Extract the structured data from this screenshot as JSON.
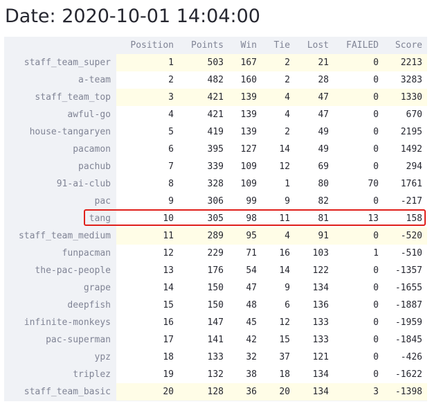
{
  "title": "Date: 2020-10-01 14:04:00",
  "columns": [
    "Position",
    "Points",
    "Win",
    "Tie",
    "Lost",
    "FAILED",
    "Score"
  ],
  "rows": [
    {
      "name": "staff_team_super",
      "position": "1",
      "points": "503",
      "win": "167",
      "tie": "2",
      "lost": "21",
      "failed": "0",
      "score": "2213",
      "highlight": true
    },
    {
      "name": "a-team",
      "position": "2",
      "points": "482",
      "win": "160",
      "tie": "2",
      "lost": "28",
      "failed": "0",
      "score": "3283",
      "highlight": false
    },
    {
      "name": "staff_team_top",
      "position": "3",
      "points": "421",
      "win": "139",
      "tie": "4",
      "lost": "47",
      "failed": "0",
      "score": "1330",
      "highlight": true
    },
    {
      "name": "awful-go",
      "position": "4",
      "points": "421",
      "win": "139",
      "tie": "4",
      "lost": "47",
      "failed": "0",
      "score": "670",
      "highlight": false
    },
    {
      "name": "house-tangaryen",
      "position": "5",
      "points": "419",
      "win": "139",
      "tie": "2",
      "lost": "49",
      "failed": "0",
      "score": "2195",
      "highlight": false
    },
    {
      "name": "pacamon",
      "position": "6",
      "points": "395",
      "win": "127",
      "tie": "14",
      "lost": "49",
      "failed": "0",
      "score": "1492",
      "highlight": false
    },
    {
      "name": "pachub",
      "position": "7",
      "points": "339",
      "win": "109",
      "tie": "12",
      "lost": "69",
      "failed": "0",
      "score": "294",
      "highlight": false
    },
    {
      "name": "91-ai-club",
      "position": "8",
      "points": "328",
      "win": "109",
      "tie": "1",
      "lost": "80",
      "failed": "70",
      "score": "1761",
      "highlight": false
    },
    {
      "name": "pac",
      "position": "9",
      "points": "306",
      "win": "99",
      "tie": "9",
      "lost": "82",
      "failed": "0",
      "score": "-217",
      "highlight": false
    },
    {
      "name": "tang",
      "position": "10",
      "points": "305",
      "win": "98",
      "tie": "11",
      "lost": "81",
      "failed": "13",
      "score": "158",
      "highlight": false
    },
    {
      "name": "staff_team_medium",
      "position": "11",
      "points": "289",
      "win": "95",
      "tie": "4",
      "lost": "91",
      "failed": "0",
      "score": "-520",
      "highlight": true
    },
    {
      "name": "funpacman",
      "position": "12",
      "points": "229",
      "win": "71",
      "tie": "16",
      "lost": "103",
      "failed": "1",
      "score": "-510",
      "highlight": false
    },
    {
      "name": "the-pac-people",
      "position": "13",
      "points": "176",
      "win": "54",
      "tie": "14",
      "lost": "122",
      "failed": "0",
      "score": "-1357",
      "highlight": false
    },
    {
      "name": "grape",
      "position": "14",
      "points": "150",
      "win": "47",
      "tie": "9",
      "lost": "134",
      "failed": "0",
      "score": "-1655",
      "highlight": false
    },
    {
      "name": "deepfish",
      "position": "15",
      "points": "150",
      "win": "48",
      "tie": "6",
      "lost": "136",
      "failed": "0",
      "score": "-1887",
      "highlight": false
    },
    {
      "name": "infinite-monkeys",
      "position": "16",
      "points": "147",
      "win": "45",
      "tie": "12",
      "lost": "133",
      "failed": "0",
      "score": "-1959",
      "highlight": false
    },
    {
      "name": "pac-superman",
      "position": "17",
      "points": "141",
      "win": "42",
      "tie": "15",
      "lost": "133",
      "failed": "0",
      "score": "-1845",
      "highlight": false
    },
    {
      "name": "ypz",
      "position": "18",
      "points": "133",
      "win": "32",
      "tie": "37",
      "lost": "121",
      "failed": "0",
      "score": "-426",
      "highlight": false
    },
    {
      "name": "triplez",
      "position": "19",
      "points": "132",
      "win": "38",
      "tie": "18",
      "lost": "134",
      "failed": "0",
      "score": "-1622",
      "highlight": false
    },
    {
      "name": "staff_team_basic",
      "position": "20",
      "points": "128",
      "win": "36",
      "tie": "20",
      "lost": "134",
      "failed": "3",
      "score": "-1398",
      "highlight": true
    }
  ],
  "colors": {
    "staff_row_highlight": "#fffde7",
    "index_background": "#f0f2f6",
    "annotation_box": "#e0201b"
  }
}
